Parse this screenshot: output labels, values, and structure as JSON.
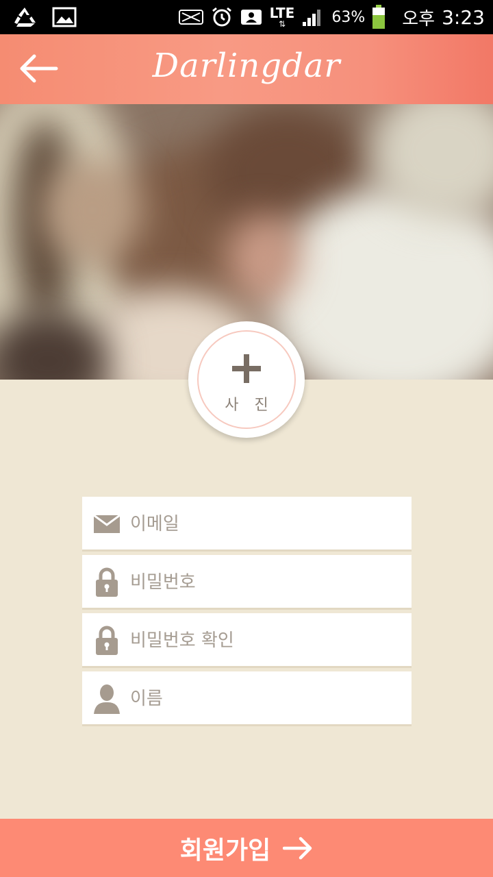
{
  "status_bar": {
    "network": "LTE",
    "battery_percent": "63%",
    "ampm": "오후",
    "time": "3:23",
    "icons": [
      "recycle-icon",
      "image-icon",
      "nfc-icon",
      "alarm-icon",
      "contacts-icon",
      "signal-icon",
      "battery-icon"
    ]
  },
  "header": {
    "title": "Darlingdar",
    "back_icon": "arrow-left-icon",
    "gradient": [
      "#f58c72",
      "#f27866"
    ]
  },
  "photo": {
    "label": "사 진",
    "icon": "plus-icon"
  },
  "form": {
    "email": {
      "placeholder": "이메일",
      "icon": "envelope-icon"
    },
    "password": {
      "placeholder": "비밀번호",
      "icon": "lock-icon"
    },
    "password_confirm": {
      "placeholder": "비밀번호 확인",
      "icon": "lock-icon"
    },
    "name": {
      "placeholder": "이름",
      "icon": "person-icon"
    }
  },
  "submit": {
    "label": "회원가입",
    "icon": "arrow-right-icon",
    "color": "#fd8a74"
  },
  "colors": {
    "background": "#efe7d4",
    "field_icon": "#a69b8f",
    "accent_ring": "#f7c9bf"
  }
}
